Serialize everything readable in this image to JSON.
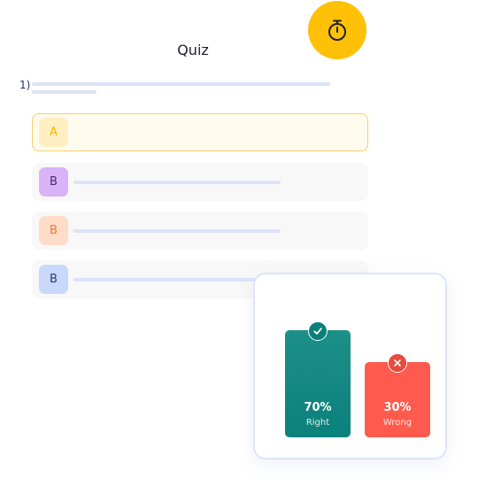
{
  "header": {
    "title": "Quiz",
    "timer_icon": "stopwatch-icon"
  },
  "question": {
    "number": "1)"
  },
  "options": [
    {
      "letter": "A",
      "selected": true,
      "tile_bg": "#FFEFC2",
      "tile_fg": "#F4B400"
    },
    {
      "letter": "B",
      "selected": false,
      "tile_bg": "#D9B2F7",
      "tile_fg": "#4A2A6B"
    },
    {
      "letter": "B",
      "selected": false,
      "tile_bg": "#FFDCC7",
      "tile_fg": "#F2782A"
    },
    {
      "letter": "B",
      "selected": false,
      "tile_bg": "#C9D8FA",
      "tile_fg": "#253A7A"
    }
  ],
  "results": {
    "right": {
      "percent": "70%",
      "label": "Right",
      "color": "#0B817C",
      "icon": "check-icon"
    },
    "wrong": {
      "percent": "30%",
      "label": "Wrong",
      "color": "#FF5A4E",
      "icon": "close-icon"
    }
  },
  "colors": {
    "accent": "#FFC107",
    "placeholder_line": "#DCE3F8"
  }
}
